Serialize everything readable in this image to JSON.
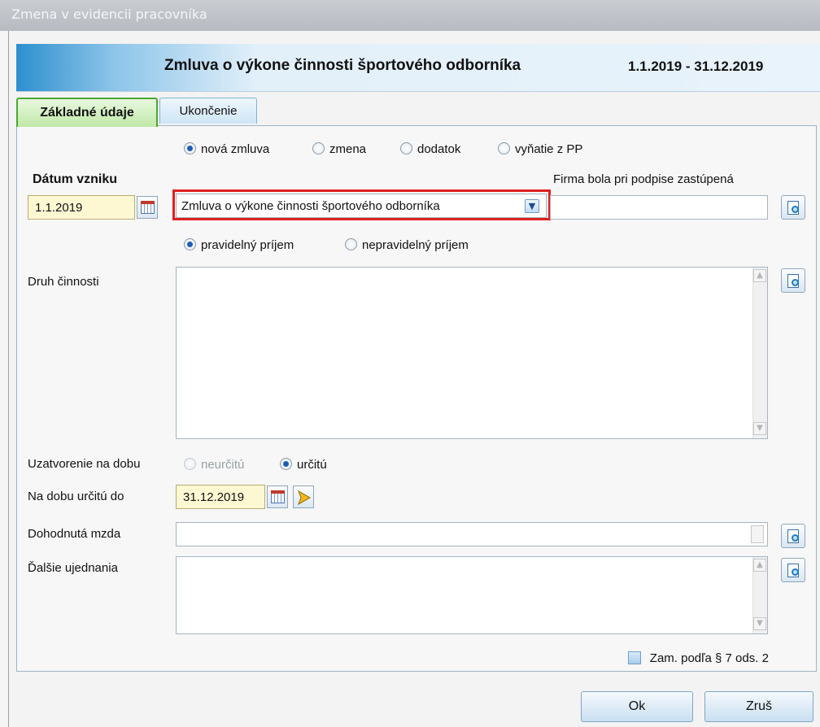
{
  "window": {
    "title": "Zmena v evidencii pracovníka"
  },
  "banner": {
    "title": "Zmluva o výkone činnosti športového odborníka",
    "dates": "1.1.2019 - 31.12.2019"
  },
  "tabs": [
    {
      "label": "Základné údaje",
      "active": true
    },
    {
      "label": "Ukončenie",
      "active": false
    }
  ],
  "contract_kind": {
    "options": [
      "nová zmluva",
      "zmena",
      "dodatok",
      "vyňatie z PP"
    ],
    "selected": "nová zmluva"
  },
  "date_origin": {
    "label": "Dátum vzniku",
    "value": "1.1.2019"
  },
  "contract_type": {
    "value": "Zmluva o výkone činnosti športového odborníka"
  },
  "representation": {
    "label": "Firma bola pri podpise zastúpená",
    "value": ""
  },
  "income": {
    "options": [
      "pravidelný príjem",
      "nepravidelný príjem"
    ],
    "selected": "pravidelný príjem"
  },
  "activity": {
    "label": "Druh činnosti",
    "value": ""
  },
  "duration": {
    "label": "Uzatvorenie na dobu",
    "options": [
      "neurčitú",
      "určitú"
    ],
    "selected": "určitú"
  },
  "fixed_term": {
    "label": "Na dobu určitú do",
    "value": "31.12.2019"
  },
  "wage": {
    "label": "Dohodnutá mzda",
    "value": ""
  },
  "other": {
    "label": "Ďalšie ujednania",
    "value": ""
  },
  "checkbox": {
    "label": "Zam. podľa § 7 ods. 2",
    "checked": false
  },
  "buttons": {
    "ok": "Ok",
    "cancel": "Zruš"
  },
  "colors": {
    "highlight": "#e02020",
    "active_tab": "#4aa832",
    "banner": "#2d8fcf"
  }
}
